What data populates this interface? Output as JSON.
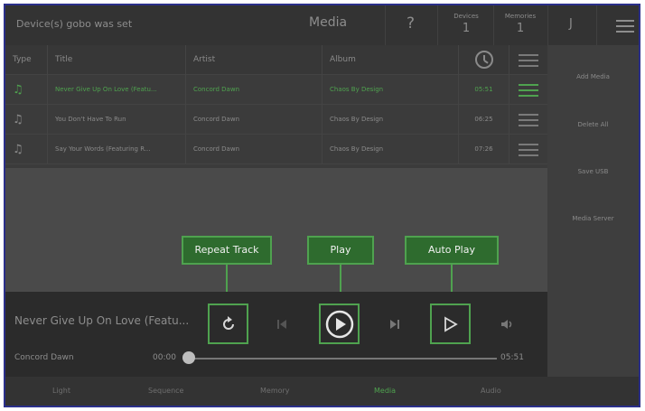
{
  "header": {
    "status": "Device(s) gobo was set",
    "title": "Media",
    "help": "?",
    "devices": {
      "label": "Devices",
      "value": "1"
    },
    "memories": {
      "label": "Memories",
      "value": "1"
    },
    "user": "J",
    "menu_icon": "hamburger-icon"
  },
  "table": {
    "columns": {
      "type": "Type",
      "title": "Title",
      "artist": "Artist",
      "album": "Album",
      "duration_icon": "clock-icon"
    },
    "rows": [
      {
        "title": "Never Give Up On Love (Featu...",
        "artist": "Concord Dawn",
        "album": "Chaos By Design",
        "duration": "05:51",
        "active": true
      },
      {
        "title": "You Don't Have To Run",
        "artist": "Concord Dawn",
        "album": "Chaos By Design",
        "duration": "06:25",
        "active": false
      },
      {
        "title": "Say Your Words (Featuring R...",
        "artist": "Concord Dawn",
        "album": "Chaos By Design",
        "duration": "07:26",
        "active": false
      }
    ]
  },
  "sidebar": {
    "add_media": "Add Media",
    "delete_all": "Delete All",
    "save_usb": "Save USB",
    "media_server": "Media Server"
  },
  "callouts": {
    "repeat": "Repeat Track",
    "play": "Play",
    "auto": "Auto Play"
  },
  "player": {
    "track_title": "Never Give Up On Love (Featu...",
    "artist": "Concord Dawn",
    "current_time": "00:00",
    "total_time": "05:51",
    "progress": 0
  },
  "nav": {
    "light": "Light",
    "sequence": "Sequence",
    "memory": "Memory",
    "media": "Media",
    "audio": "Audio"
  },
  "colors": {
    "accent": "#4fa24f",
    "border": "#2b2f8a"
  }
}
